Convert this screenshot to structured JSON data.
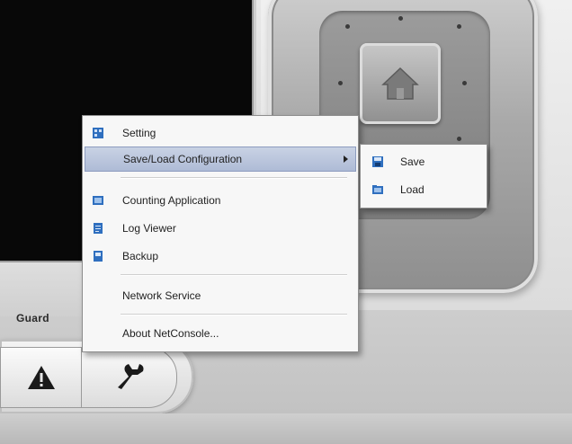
{
  "menu": {
    "items": [
      {
        "label": "Setting",
        "icon": "setting-icon"
      },
      {
        "label": "Save/Load Configuration",
        "icon": ""
      },
      {
        "label": "Counting Application",
        "icon": "counting-application-icon"
      },
      {
        "label": "Log Viewer",
        "icon": "log-viewer-icon"
      },
      {
        "label": "Backup",
        "icon": "backup-icon"
      },
      {
        "label": "Network Service",
        "icon": ""
      },
      {
        "label": "About NetConsole...",
        "icon": ""
      }
    ]
  },
  "submenu": {
    "items": [
      {
        "label": "Save",
        "icon": "save-icon"
      },
      {
        "label": "Load",
        "icon": "load-icon"
      }
    ]
  },
  "tabs": {
    "guard_label": "Guard",
    "buttons": [
      {
        "icon": "warning-icon"
      },
      {
        "icon": "wrench-icon"
      }
    ]
  },
  "colors": {
    "highlight": "#b7c3dc",
    "menu_bg": "#f7f7f7",
    "icon_blue": "#2f6fbf"
  }
}
